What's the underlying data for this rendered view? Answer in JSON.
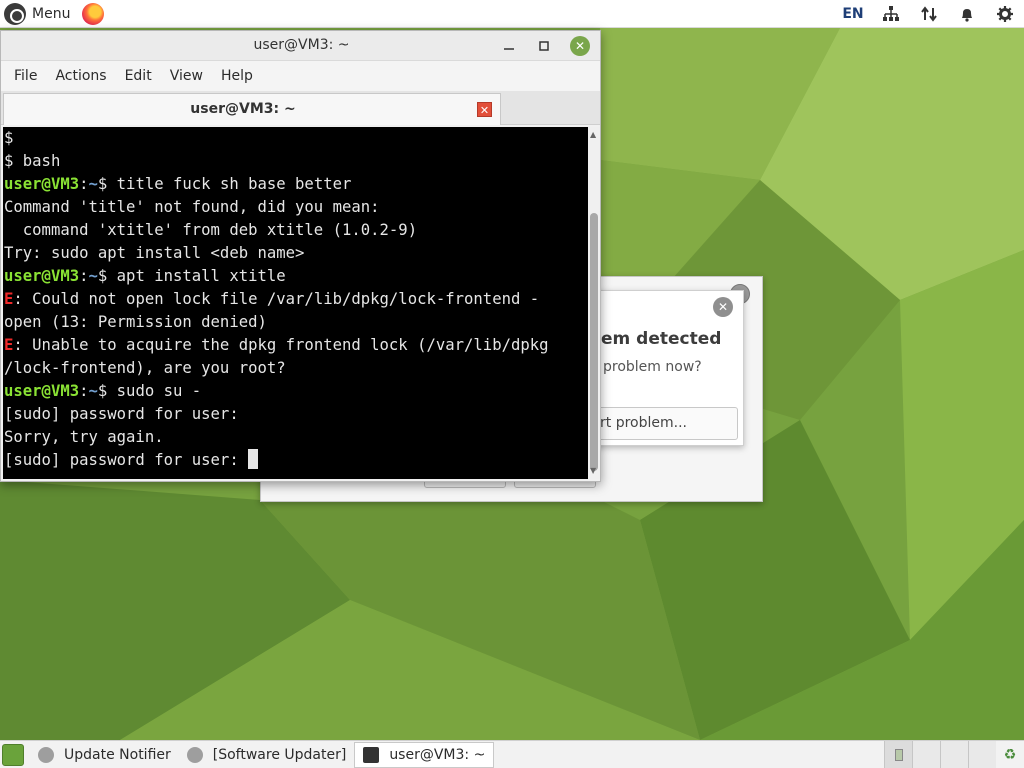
{
  "top_panel": {
    "menu_label": "Menu",
    "language": "EN",
    "icons": [
      "network-icon",
      "transfer-icon",
      "bell-icon",
      "gear-icon"
    ]
  },
  "terminal": {
    "window_title": "user@VM3: ~",
    "menu": [
      "File",
      "Actions",
      "Edit",
      "View",
      "Help"
    ],
    "tab_title": "user@VM3: ~",
    "lines": [
      [
        {
          "t": "$",
          "c": ""
        }
      ],
      [
        {
          "t": "$ bash",
          "c": ""
        }
      ],
      [
        {
          "t": "user@VM3",
          "c": "g"
        },
        {
          "t": ":",
          "c": ""
        },
        {
          "t": "~",
          "c": "b"
        },
        {
          "t": "$ title fuck sh base better",
          "c": ""
        }
      ],
      [
        {
          "t": "Command 'title' not found, did you mean:",
          "c": ""
        }
      ],
      [
        {
          "t": "  command 'xtitle' from deb xtitle (1.0.2-9)",
          "c": ""
        }
      ],
      [
        {
          "t": "Try: sudo apt install <deb name>",
          "c": ""
        }
      ],
      [
        {
          "t": "user@VM3",
          "c": "g"
        },
        {
          "t": ":",
          "c": ""
        },
        {
          "t": "~",
          "c": "b"
        },
        {
          "t": "$ apt install xtitle",
          "c": ""
        }
      ],
      [
        {
          "t": "E",
          "c": "e"
        },
        {
          "t": ": Could not open lock file /var/lib/dpkg/lock-frontend -",
          "c": ""
        }
      ],
      [
        {
          "t": "open (13: Permission denied)",
          "c": ""
        }
      ],
      [
        {
          "t": "E",
          "c": "e"
        },
        {
          "t": ": Unable to acquire the dpkg frontend lock (/var/lib/dpkg",
          "c": ""
        }
      ],
      [
        {
          "t": "/lock-frontend), are you root?",
          "c": ""
        }
      ],
      [
        {
          "t": "user@VM3",
          "c": "g"
        },
        {
          "t": ":",
          "c": ""
        },
        {
          "t": "~",
          "c": "b"
        },
        {
          "t": "$ sudo su -",
          "c": ""
        }
      ],
      [
        {
          "t": "[sudo] password for user:",
          "c": ""
        }
      ],
      [
        {
          "t": "Sorry, try again.",
          "c": ""
        }
      ],
      [
        {
          "t": "[sudo] password for user: ",
          "c": ""
        }
      ]
    ]
  },
  "problem_dialog": {
    "title": "em detected",
    "question": " problem now?",
    "report_label": "rt problem..."
  },
  "taskbar": {
    "tasks": [
      "Update Notifier",
      "[Software Updater]",
      "user@VM3: ~"
    ]
  },
  "colors": {
    "prompt_user": "#8ae234",
    "prompt_path": "#729fcf",
    "error": "#ef2929",
    "wallpaper": "#6f9a3a"
  }
}
